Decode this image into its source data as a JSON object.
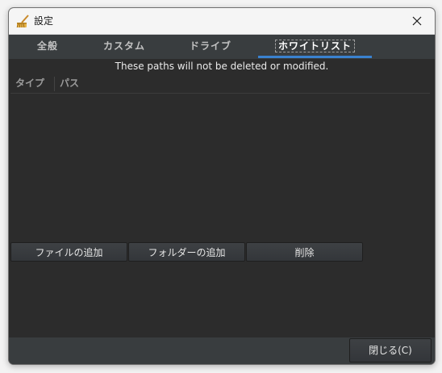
{
  "window": {
    "title": "設定",
    "app_icon": "broom-icon",
    "close_icon": "close-icon"
  },
  "tabs": [
    {
      "label": "全般",
      "active": false
    },
    {
      "label": "カスタム",
      "active": false
    },
    {
      "label": "ドライブ",
      "active": false
    },
    {
      "label": "ホワイトリスト",
      "active": true
    }
  ],
  "whitelist": {
    "notice": "These paths will not be deleted or modified.",
    "columns": [
      "タイプ",
      "パス"
    ],
    "rows": []
  },
  "buttons": {
    "add_file": "ファイルの追加",
    "add_folder": "フォルダーの追加",
    "delete": "削除"
  },
  "footer": {
    "close": "閉じる(C)"
  },
  "colors": {
    "accent": "#3a82d0",
    "window_bg": "#2b2b2b",
    "tab_bar_bg": "#393d3f"
  }
}
